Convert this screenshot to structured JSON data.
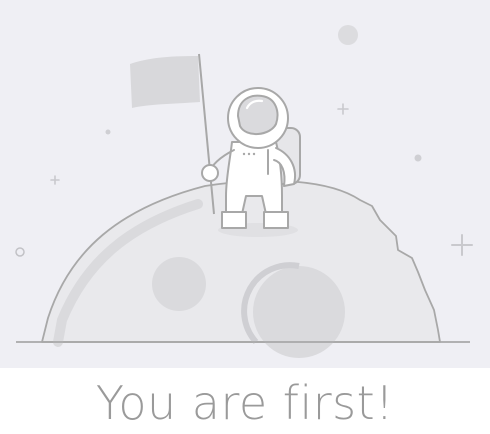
{
  "empty_state": {
    "message": "You are first!",
    "illustration_icon": "astronaut-on-moon-icon"
  },
  "colors": {
    "background": "#efeff4",
    "line": "#a8a8a8",
    "fill": "#d8d8db",
    "text": "#9a9a9a"
  }
}
